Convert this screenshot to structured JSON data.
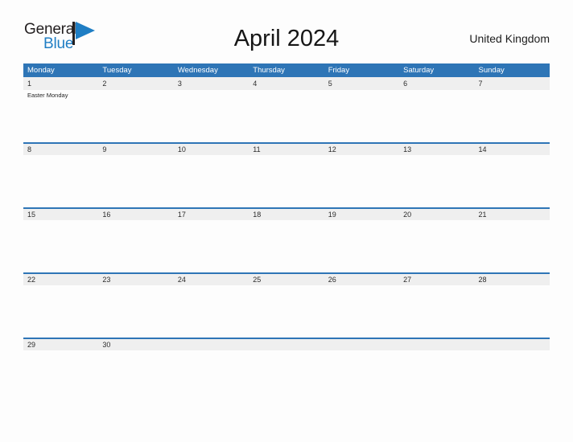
{
  "brand": {
    "name_top": "General",
    "name_bottom": "Blue",
    "flag_icon": "flag-triangle-icon",
    "color_dark": "#231f20",
    "color_blue": "#1f7ec4"
  },
  "header": {
    "title": "April 2024",
    "region": "United Kingdom"
  },
  "theme": {
    "header_blue": "#2e75b6",
    "band_gray": "#efefef",
    "page_background": "#fdfdfd",
    "text_dark": "#1a1a1a"
  },
  "calendar": {
    "weekdays": [
      "Monday",
      "Tuesday",
      "Wednesday",
      "Thursday",
      "Friday",
      "Saturday",
      "Sunday"
    ],
    "weeks": [
      {
        "days": [
          {
            "date": "1",
            "events": [
              "Easter Monday"
            ]
          },
          {
            "date": "2",
            "events": []
          },
          {
            "date": "3",
            "events": []
          },
          {
            "date": "4",
            "events": []
          },
          {
            "date": "5",
            "events": []
          },
          {
            "date": "6",
            "events": []
          },
          {
            "date": "7",
            "events": []
          }
        ]
      },
      {
        "days": [
          {
            "date": "8",
            "events": []
          },
          {
            "date": "9",
            "events": []
          },
          {
            "date": "10",
            "events": []
          },
          {
            "date": "11",
            "events": []
          },
          {
            "date": "12",
            "events": []
          },
          {
            "date": "13",
            "events": []
          },
          {
            "date": "14",
            "events": []
          }
        ]
      },
      {
        "days": [
          {
            "date": "15",
            "events": []
          },
          {
            "date": "16",
            "events": []
          },
          {
            "date": "17",
            "events": []
          },
          {
            "date": "18",
            "events": []
          },
          {
            "date": "19",
            "events": []
          },
          {
            "date": "20",
            "events": []
          },
          {
            "date": "21",
            "events": []
          }
        ]
      },
      {
        "days": [
          {
            "date": "22",
            "events": []
          },
          {
            "date": "23",
            "events": []
          },
          {
            "date": "24",
            "events": []
          },
          {
            "date": "25",
            "events": []
          },
          {
            "date": "26",
            "events": []
          },
          {
            "date": "27",
            "events": []
          },
          {
            "date": "28",
            "events": []
          }
        ]
      },
      {
        "days": [
          {
            "date": "29",
            "events": []
          },
          {
            "date": "30",
            "events": []
          },
          {
            "date": "",
            "events": []
          },
          {
            "date": "",
            "events": []
          },
          {
            "date": "",
            "events": []
          },
          {
            "date": "",
            "events": []
          },
          {
            "date": "",
            "events": []
          }
        ]
      }
    ]
  }
}
